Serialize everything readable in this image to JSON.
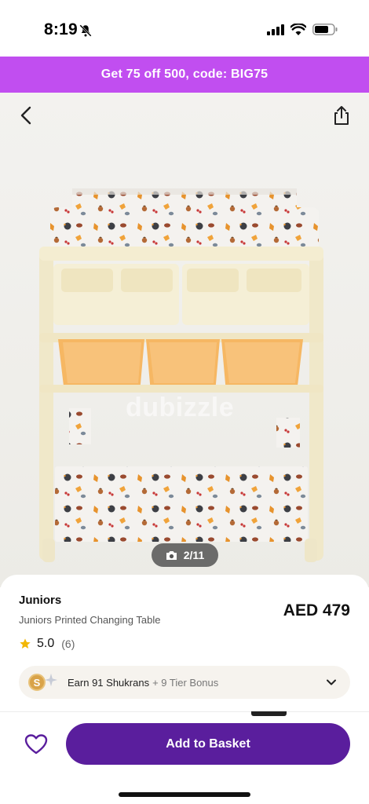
{
  "status_bar": {
    "time": "8:19",
    "icons": [
      "bell-slash-icon",
      "cellular-signal-icon",
      "wifi-icon",
      "battery-icon"
    ]
  },
  "promo": {
    "text": "Get 75 off 500, code: BIG75",
    "background": "#c14ef0"
  },
  "gallery": {
    "watermark": "dubizzle",
    "counter": "2/11",
    "icons": [
      "back-arrow-icon",
      "share-icon",
      "camera-icon"
    ]
  },
  "product": {
    "brand": "Juniors",
    "name": "Juniors Printed Changing Table",
    "price": "AED 479",
    "rating": "5.0",
    "rating_count": "(6)"
  },
  "shukran": {
    "coin_letter": "S",
    "earn_text": "Earn 91 Shukrans",
    "bonus_text": "+ 9 Tier Bonus"
  },
  "actions": {
    "add_to_basket": "Add to Basket",
    "accent": "#5a1e9d"
  }
}
